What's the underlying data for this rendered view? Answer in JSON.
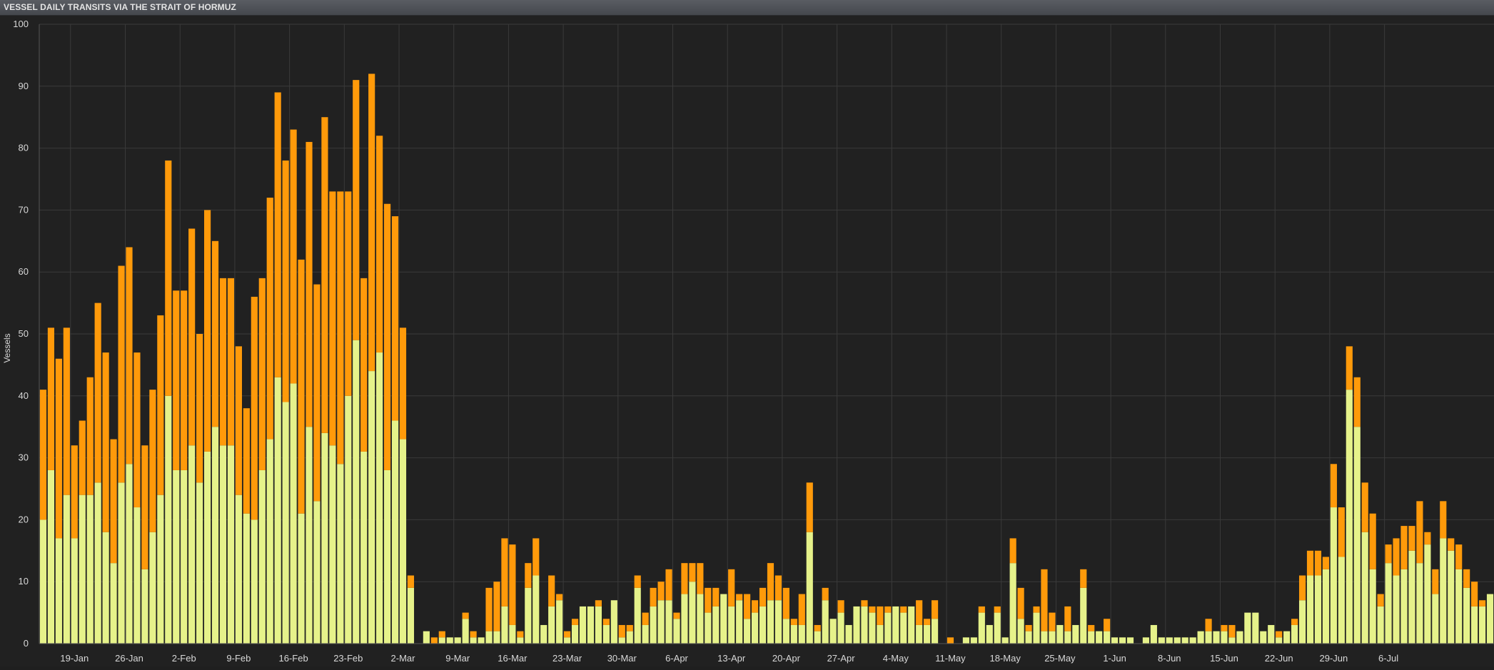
{
  "title": "VESSEL DAILY TRANSITS VIA THE STRAIT OF HORMUZ",
  "colors": {
    "background": "#212121",
    "series_a": "#e6f28a",
    "series_b": "#ff9a0a",
    "grid": "#3a3a3a",
    "text": "#d8d8d8"
  },
  "chart_data": {
    "type": "bar",
    "stacked": true,
    "title": "VESSEL DAILY TRANSITS VIA THE STRAIT OF HORMUZ",
    "xlabel": "",
    "ylabel": "Vessels",
    "ylim": [
      0,
      100
    ],
    "yticks": [
      0,
      10,
      20,
      30,
      40,
      50,
      60,
      70,
      80,
      90,
      100
    ],
    "grid": true,
    "x_start": "2025-01-15",
    "xtick_labels": [
      "19-Jan",
      "26-Jan",
      "2-Feb",
      "9-Feb",
      "16-Feb",
      "23-Feb",
      "2-Mar",
      "9-Mar",
      "16-Mar",
      "23-Mar",
      "30-Mar",
      "6-Apr",
      "13-Apr",
      "20-Apr",
      "27-Apr",
      "4-May",
      "11-May",
      "18-May",
      "25-May",
      "1-Jun",
      "8-Jun",
      "15-Jun",
      "22-Jun",
      "29-Jun",
      "6-Jul"
    ],
    "series": [
      {
        "values": [
          20,
          28,
          17,
          24,
          17,
          24,
          24,
          26,
          18,
          13,
          26,
          29,
          22,
          12,
          18,
          24,
          40,
          28,
          28,
          32,
          26,
          31,
          35,
          32,
          32,
          24,
          21,
          20,
          28,
          33,
          43,
          39,
          42,
          21,
          35,
          23,
          34,
          32,
          29,
          40,
          49,
          31,
          44,
          47,
          28,
          36,
          33,
          9,
          0,
          2,
          0,
          1,
          1,
          1,
          4,
          1,
          1,
          2,
          2,
          6,
          3,
          1,
          9,
          11,
          3,
          6,
          7,
          1,
          3,
          6,
          6,
          6,
          3,
          7,
          1,
          2,
          9,
          3,
          6,
          7,
          7,
          4,
          8,
          10,
          8,
          5,
          6,
          8,
          6,
          7,
          4,
          5,
          6,
          7,
          7,
          4,
          3,
          3,
          18,
          2,
          7,
          4,
          5,
          3,
          6,
          6,
          5,
          3,
          5,
          6,
          5,
          6,
          3,
          3,
          4,
          0,
          0,
          0,
          1,
          1,
          5,
          3,
          5,
          1,
          13,
          4,
          2,
          5,
          2,
          2,
          3,
          2,
          3,
          9,
          2,
          2,
          2,
          1,
          1,
          1,
          0,
          1,
          3,
          1,
          1,
          1,
          1,
          1,
          2,
          2,
          2,
          2,
          1,
          2,
          5,
          5,
          2,
          3,
          1,
          2,
          3,
          7,
          11,
          11,
          12,
          22,
          14,
          41,
          35,
          18,
          12,
          6,
          13,
          11,
          12,
          15,
          13,
          16,
          8,
          17,
          15,
          12,
          9,
          6,
          6,
          8
        ]
      },
      {
        "values": [
          21,
          23,
          29,
          27,
          15,
          12,
          19,
          29,
          29,
          20,
          35,
          35,
          25,
          20,
          23,
          29,
          38,
          29,
          29,
          35,
          24,
          39,
          30,
          27,
          27,
          24,
          17,
          36,
          31,
          39,
          46,
          39,
          41,
          41,
          46,
          35,
          51,
          41,
          44,
          33,
          42,
          28,
          48,
          35,
          43,
          33,
          18,
          2,
          0,
          0,
          1,
          1,
          0,
          0,
          1,
          1,
          0,
          7,
          8,
          11,
          13,
          1,
          4,
          6,
          0,
          5,
          1,
          1,
          1,
          0,
          0,
          1,
          1,
          0,
          2,
          1,
          2,
          2,
          3,
          3,
          5,
          1,
          5,
          3,
          5,
          4,
          3,
          0,
          6,
          1,
          4,
          2,
          3,
          6,
          4,
          5,
          1,
          5,
          8,
          1,
          2,
          0,
          2,
          0,
          0,
          1,
          1,
          3,
          1,
          0,
          1,
          0,
          4,
          1,
          3,
          0,
          1,
          0,
          0,
          0,
          1,
          0,
          1,
          0,
          4,
          5,
          1,
          1,
          10,
          3,
          0,
          4,
          0,
          3,
          1,
          0,
          2,
          0,
          0,
          0,
          0,
          0,
          0,
          0,
          0,
          0,
          0,
          0,
          0,
          2,
          0,
          1,
          2,
          0,
          0,
          0,
          0,
          0,
          1,
          0,
          1,
          4,
          4,
          4,
          2,
          7,
          8,
          7,
          8,
          8,
          9,
          2,
          3,
          6,
          7,
          4,
          10,
          2,
          4,
          6,
          2,
          4,
          3,
          4,
          1,
          0
        ]
      }
    ]
  }
}
